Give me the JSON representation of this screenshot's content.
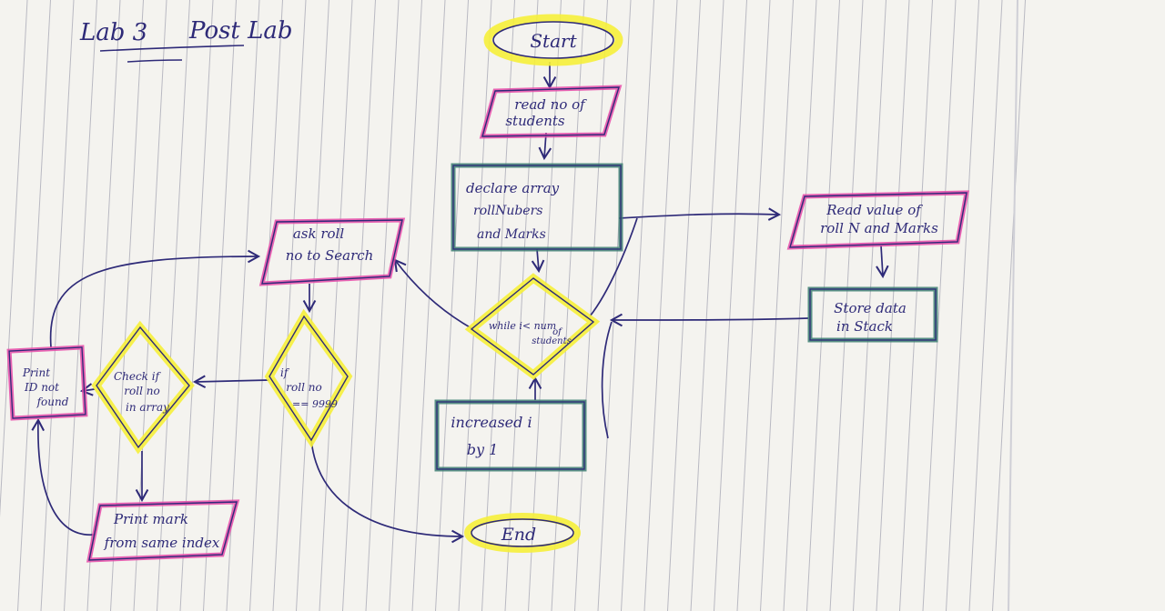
{
  "page": {
    "heading": "Lab 3",
    "subheading": "Post Lab"
  },
  "colors": {
    "paper": "#f4f3ef",
    "rule": "#b9b9c2",
    "ink": "#2e2a78",
    "yellow_highlight": "#f6ef3a",
    "pink_highlight": "#e64aa8",
    "teal_highlight": "#3d7e72"
  },
  "nodes": {
    "start": {
      "label": "Start",
      "shape": "terminal",
      "highlight": "yellow"
    },
    "read_no": {
      "lines": [
        "read no of",
        "students"
      ],
      "shape": "parallelogram",
      "highlight": "pink"
    },
    "declare": {
      "lines": [
        "declare array",
        "rollNubers",
        "and Marks"
      ],
      "shape": "process",
      "highlight": "teal"
    },
    "while": {
      "lines": [
        "while i< num",
        "of",
        "students"
      ],
      "shape": "decision",
      "highlight": "yellow"
    },
    "read_value": {
      "lines": [
        "Read value of",
        "roll N and Marks"
      ],
      "shape": "parallelogram",
      "highlight": "pink"
    },
    "store": {
      "lines": [
        "Store data",
        "in Stack"
      ],
      "shape": "process",
      "highlight": "teal"
    },
    "increase": {
      "lines": [
        "increased i",
        "by 1"
      ],
      "shape": "process",
      "highlight": "teal"
    },
    "ask_roll": {
      "lines": [
        "ask roll",
        "no to Search"
      ],
      "shape": "parallelogram",
      "highlight": "pink"
    },
    "if_roll": {
      "lines": [
        "if",
        "roll no",
        "== 9999"
      ],
      "shape": "decision",
      "highlight": "yellow"
    },
    "check": {
      "lines": [
        "Check if",
        "roll no",
        "in array"
      ],
      "shape": "decision",
      "highlight": "yellow"
    },
    "print_not_found": {
      "lines": [
        "Print",
        "ID not",
        "found"
      ],
      "shape": "process",
      "highlight": "pink"
    },
    "print_mark": {
      "lines": [
        "Print mark",
        "from same index"
      ],
      "shape": "parallelogram",
      "highlight": "pink"
    },
    "end": {
      "label": "End",
      "shape": "terminal",
      "highlight": "yellow"
    }
  }
}
